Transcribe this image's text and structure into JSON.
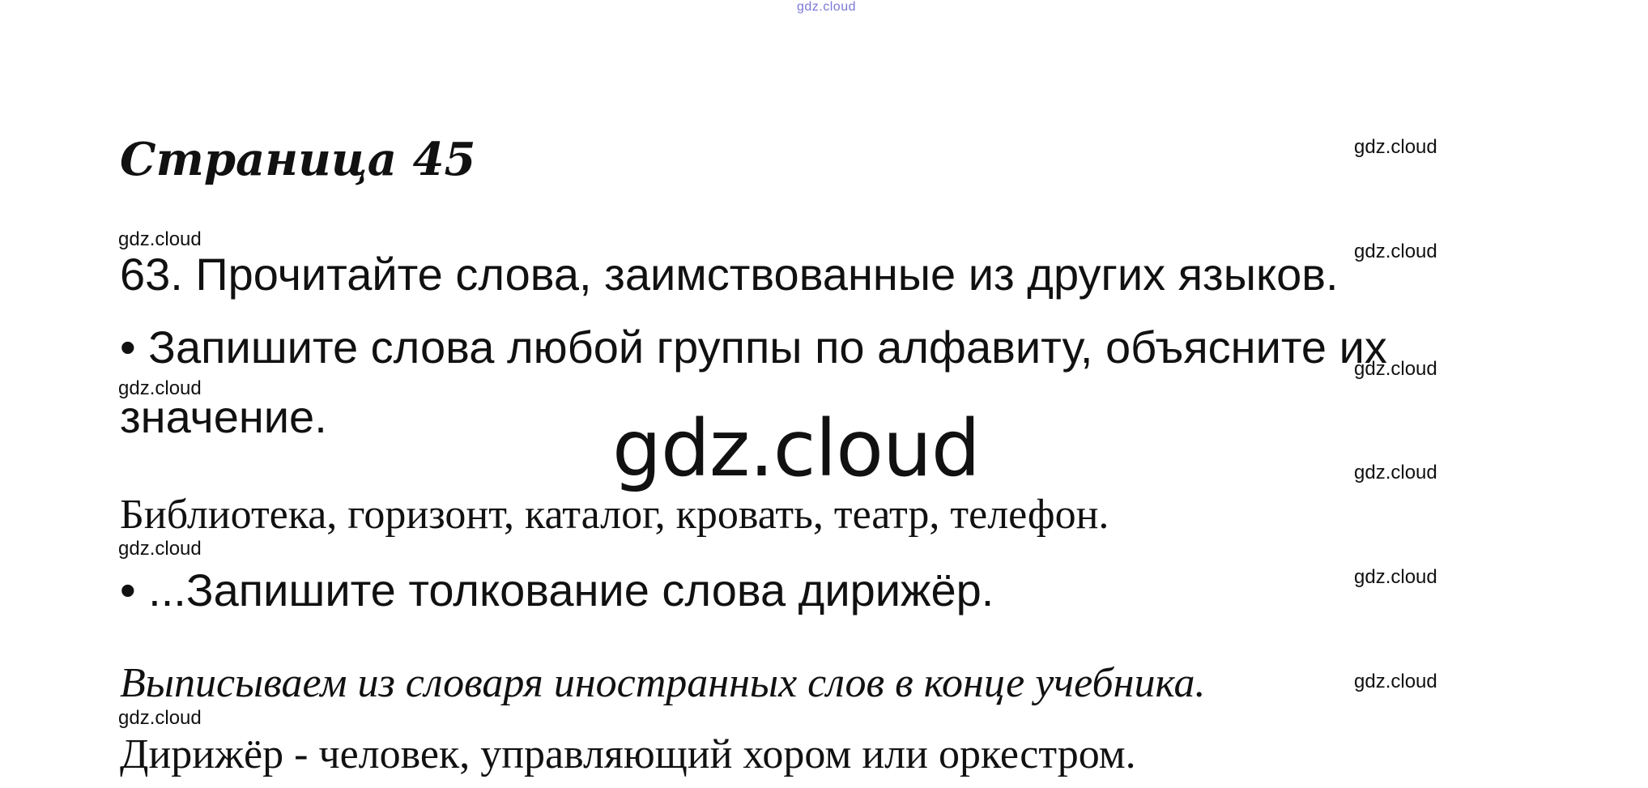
{
  "watermark": {
    "top": "gdz.cloud",
    "small": "gdz.cloud",
    "big": "gdz.cloud"
  },
  "page": {
    "title": "Страница 45"
  },
  "task": {
    "line1": "63. Прочитайте слова, заимствованные из других языков.",
    "line2": "• Запишите слова любой группы по алфавиту, объясните их",
    "line3": "значение.",
    "words": "Библиотека, горизонт, каталог, кровать, театр, телефон.",
    "line5": "• ...Запишите толкование слова дирижёр."
  },
  "answer": {
    "note": "Выписываем из словаря иностранных слов в конце учебника.",
    "definition": "Дирижёр - человек, управляющий хором или оркестром."
  }
}
